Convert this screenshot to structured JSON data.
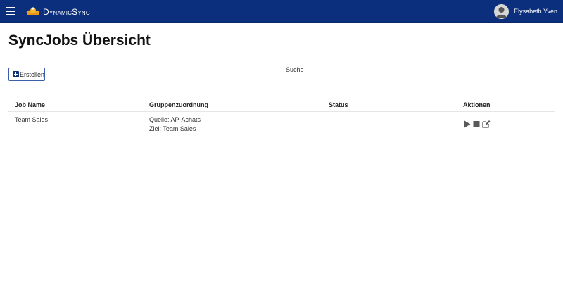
{
  "header": {
    "brand": "DynamicSync",
    "user_name": "Elysabeth Yven",
    "icons": [
      "hamburger-menu-icon",
      "sync-logo-icon",
      "avatar"
    ]
  },
  "page": {
    "title": "SyncJobs Übersicht",
    "create_label": "Erstellen",
    "search_label": "Suche",
    "search_value": ""
  },
  "table": {
    "columns": [
      "Job Name",
      "Gruppenzuordnung",
      "Status",
      "Aktionen"
    ],
    "rows": [
      {
        "job_name": "Team Sales",
        "source": "Quelle: AP-Achats",
        "target": "Ziel: Team Sales",
        "status": "",
        "actions": [
          "play-icon",
          "stop-icon",
          "edit-icon"
        ]
      }
    ]
  },
  "colors": {
    "header_bg": "#0b2f7d",
    "accent": "#0b2f7d",
    "logo": "#f0a41c"
  }
}
